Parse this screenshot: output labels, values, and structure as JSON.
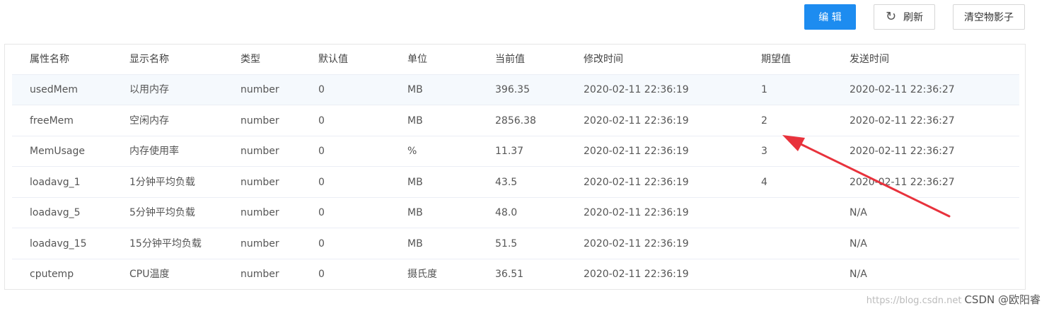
{
  "toolbar": {
    "edit_label": "编 辑",
    "refresh_label": "刷新",
    "clear_label": "清空物影子",
    "refresh_icon": "refresh-icon"
  },
  "table": {
    "headers": [
      "属性名称",
      "显示名称",
      "类型",
      "默认值",
      "单位",
      "当前值",
      "修改时间",
      "期望值",
      "发送时间"
    ],
    "rows": [
      [
        "usedMem",
        "以用内存",
        "number",
        "0",
        "MB",
        "396.35",
        "2020-02-11 22:36:19",
        "1",
        "2020-02-11 22:36:27"
      ],
      [
        "freeMem",
        "空闲内存",
        "number",
        "0",
        "MB",
        "2856.38",
        "2020-02-11 22:36:19",
        "2",
        "2020-02-11 22:36:27"
      ],
      [
        "MemUsage",
        "内存使用率",
        "number",
        "0",
        "%",
        "11.37",
        "2020-02-11 22:36:19",
        "3",
        "2020-02-11 22:36:27"
      ],
      [
        "loadavg_1",
        "1分钟平均负载",
        "number",
        "0",
        "MB",
        "43.5",
        "2020-02-11 22:36:19",
        "4",
        "2020-02-11 22:36:27"
      ],
      [
        "loadavg_5",
        "5分钟平均负载",
        "number",
        "0",
        "MB",
        "48.0",
        "2020-02-11 22:36:19",
        "",
        "N/A"
      ],
      [
        "loadavg_15",
        "15分钟平均负载",
        "number",
        "0",
        "MB",
        "51.5",
        "2020-02-11 22:36:19",
        "",
        "N/A"
      ],
      [
        "cputemp",
        "CPU温度",
        "number",
        "0",
        "摄氏度",
        "36.51",
        "2020-02-11 22:36:19",
        "",
        "N/A"
      ]
    ]
  },
  "colors": {
    "primary": "#1d8cf0",
    "row_highlight": "#f5f9fd",
    "annotation": "#e8323c"
  },
  "watermark": {
    "url": "https://blog.csdn.net",
    "text": "CSDN @欧阳睿"
  }
}
